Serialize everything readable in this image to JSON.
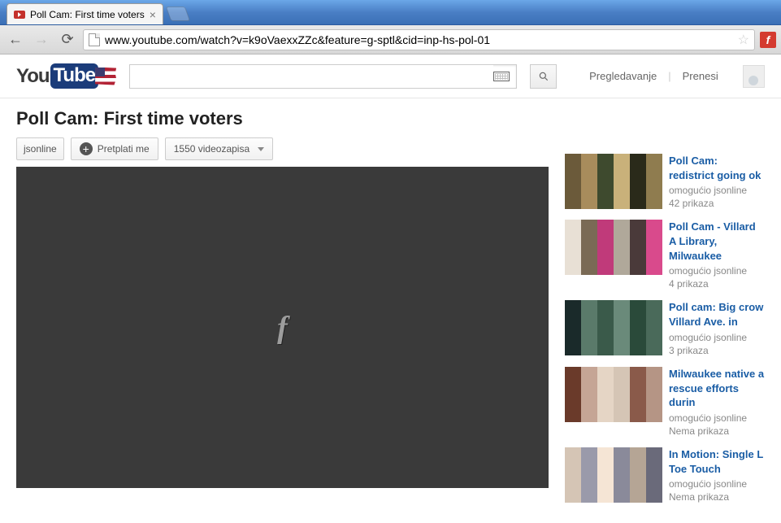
{
  "browser": {
    "tab_title": "Poll Cam: First time voters",
    "url": "www.youtube.com/watch?v=k9oVaexxZZc&feature=g-sptl&cid=inp-hs-pol-01"
  },
  "masthead": {
    "browse_label": "Pregledavanje",
    "upload_label": "Prenesi"
  },
  "video": {
    "title": "Poll Cam: First time voters",
    "channel": "jsonline",
    "subscribe_label": "Pretplati me",
    "video_count_label": "1550 videozapisa"
  },
  "related": [
    {
      "title": "Poll Cam: redistrict going ok",
      "by": "omogućio jsonline",
      "views": "42 prikaza",
      "colors": [
        "#6b5a3a",
        "#a88c5c",
        "#3e4a2e",
        "#c9b17a",
        "#2a2a1a",
        "#8f7c4f"
      ]
    },
    {
      "title": "Poll Cam - Villard A Library, Milwaukee",
      "by": "omogućio jsonline",
      "views": "4 prikaza",
      "colors": [
        "#d94a8c",
        "#e8e0d5",
        "#7a6a55",
        "#c03a7a",
        "#b0a89a",
        "#4a3a3a"
      ]
    },
    {
      "title": "Poll cam: Big crow Villard Ave. in",
      "by": "omogućio jsonline",
      "views": "3 prikaza",
      "colors": [
        "#2a4a3a",
        "#4a6a5a",
        "#1a2a2a",
        "#5a7a6a",
        "#3a5a4a",
        "#6a8a7a"
      ]
    },
    {
      "title": "Milwaukee native a rescue efforts durin",
      "by": "omogućio jsonline",
      "views": "Nema prikaza",
      "colors": [
        "#d5c5b5",
        "#8a5a4a",
        "#b59585",
        "#6a3a2a",
        "#c5a595",
        "#e5d5c5"
      ]
    },
    {
      "title": "In Motion: Single L Toe Touch",
      "by": "omogućio jsonline",
      "views": "Nema prikaza",
      "colors": [
        "#f5e5d5",
        "#8a8a9a",
        "#b5a595",
        "#6a6a7a",
        "#d5c5b5",
        "#9a9aaa"
      ]
    }
  ]
}
